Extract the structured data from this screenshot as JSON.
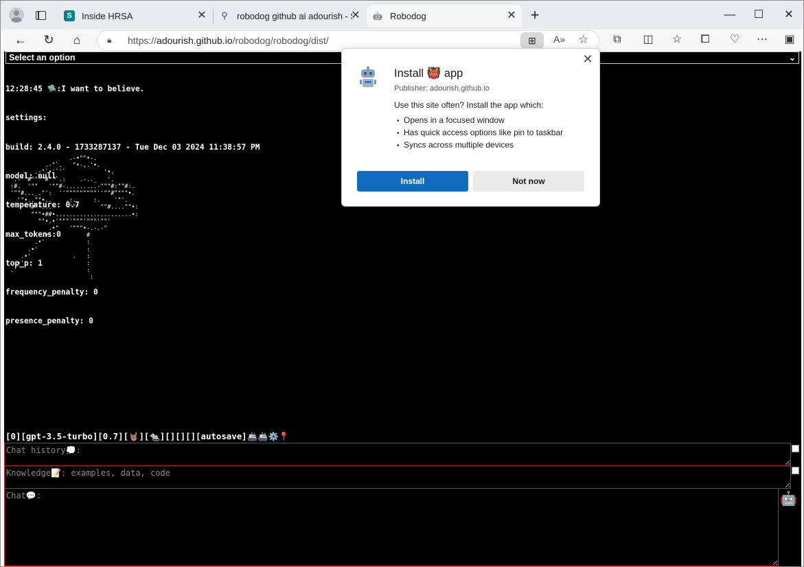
{
  "browser": {
    "tabs": [
      {
        "title": "Inside HRSA",
        "icon": "sharepoint-icon",
        "active": false
      },
      {
        "title": "robodog github ai adourish - Sea",
        "icon": "search-icon",
        "active": false
      },
      {
        "title": "Robodog",
        "icon": "robot-icon",
        "active": true
      }
    ],
    "url_prefix": "https://",
    "url_host": "adourish.github.io",
    "url_path": "/robodog/robodog/dist/"
  },
  "page": {
    "select_label": "Select an option",
    "console_lines": [
      "12:28:45 🛸:I want to believe.",
      "settings:",
      "build: 2.4.0 - 1733287137 - Tue Dec 03 2024 11:38:57 PM",
      "model: null",
      "temperature: 0.7",
      "max_tokens:0",
      "top_p: 1",
      "frequency_penalty: 0",
      "presence_penalty: 0"
    ],
    "ascii_art": "                  .-•\"\"•-.\n           .-\"`.   \"•-,.'•.\n        .-\"`•'`'`           '•.\n  .-'\"#\"\"\"\"#\"\"`.:    .-.._   '.\n :#.  '\"\"   '\"\"#-.........-\"\"\"#:\"\"#:.\n '\"\"#..._.\"':  ''\"\"\"\"\"\"\"\"\"''\"\"#\"\"\"\"•.\n   '\"•..\"\"•..    .:.     :.    '\"'.\n     '\"#\"•...     '\"'      \"\"#....\"\"•:\n       \"\"\"•##•......................•:\n         \"\"•.•'\"\"\"'\"\"\"'\"\"\"'\"\"'\n            .•\"   '\"\"\"•-.-.-\"\n          .•'          #\n        .•'            :\n      .•'              :\n    .•'            .   :\n  .•'                  :\n .'                    :\n                        :",
    "status_line": "[0][gpt-3.5-turbo][0.7][🤘🏽][🐀][][][][autosave]🚢🚢⚙️📍",
    "chat_history_placeholder": "Chat history💭:",
    "knowledge_placeholder": "Knowledge📝: examples, data, code",
    "chat_placeholder": "Chat💬:"
  },
  "install_popup": {
    "title": "Install 👹 app",
    "publisher": "Publisher: adourish.github.io",
    "description": "Use this site often? Install the app which:",
    "features": [
      "Opens in a focused window",
      "Has quick access options like pin to taskbar",
      "Syncs across multiple devices"
    ],
    "install_label": "Install",
    "not_now_label": "Not now"
  }
}
